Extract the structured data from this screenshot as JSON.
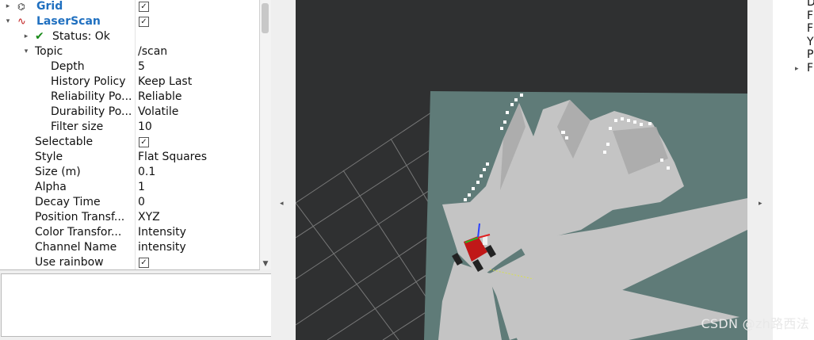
{
  "displays": {
    "items": [
      {
        "arrow": "▸",
        "icon": "grid-icon",
        "glyph": "⌬",
        "label": "Grid",
        "value": "",
        "checked": true,
        "blue": true
      },
      {
        "arrow": "▾",
        "icon": "laserscan-icon",
        "glyph": "∿",
        "label": "LaserScan",
        "value": "",
        "checked": true,
        "blue": true
      },
      {
        "arrow": "▸",
        "icon": "check-mark-icon",
        "glyph": "✔",
        "label": "Status: Ok",
        "value": "",
        "checked": null
      },
      {
        "arrow": "▾",
        "icon": "",
        "glyph": "",
        "label": "Topic",
        "value": "/scan",
        "checked": null
      },
      {
        "arrow": "",
        "icon": "",
        "glyph": "",
        "label": "Depth",
        "value": "5",
        "checked": null
      },
      {
        "arrow": "",
        "icon": "",
        "glyph": "",
        "label": "History Policy",
        "value": "Keep Last",
        "checked": null
      },
      {
        "arrow": "",
        "icon": "",
        "glyph": "",
        "label": "Reliability Po...",
        "value": "Reliable",
        "checked": null
      },
      {
        "arrow": "",
        "icon": "",
        "glyph": "",
        "label": "Durability Po...",
        "value": "Volatile",
        "checked": null
      },
      {
        "arrow": "",
        "icon": "",
        "glyph": "",
        "label": "Filter size",
        "value": "10",
        "checked": null
      },
      {
        "arrow": "",
        "icon": "",
        "glyph": "",
        "label": "Selectable",
        "value": "",
        "checked": true
      },
      {
        "arrow": "",
        "icon": "",
        "glyph": "",
        "label": "Style",
        "value": "Flat Squares",
        "checked": null
      },
      {
        "arrow": "",
        "icon": "",
        "glyph": "",
        "label": "Size (m)",
        "value": "0.1",
        "checked": null
      },
      {
        "arrow": "",
        "icon": "",
        "glyph": "",
        "label": "Alpha",
        "value": "1",
        "checked": null
      },
      {
        "arrow": "",
        "icon": "",
        "glyph": "",
        "label": "Decay Time",
        "value": "0",
        "checked": null
      },
      {
        "arrow": "",
        "icon": "",
        "glyph": "",
        "label": "Position Transf...",
        "value": "XYZ",
        "checked": null
      },
      {
        "arrow": "",
        "icon": "",
        "glyph": "",
        "label": "Color Transfor...",
        "value": "Intensity",
        "checked": null
      },
      {
        "arrow": "",
        "icon": "",
        "glyph": "",
        "label": "Channel Name",
        "value": "intensity",
        "checked": null
      },
      {
        "arrow": "",
        "icon": "",
        "glyph": "",
        "label": "Use rainbow",
        "value": "",
        "checked": true
      }
    ]
  },
  "right_panel": {
    "items": [
      "D",
      "F",
      "F",
      "Y",
      "P",
      "F"
    ]
  },
  "watermark": "CSDN @zh路西法",
  "colors": {
    "link_blue": "#2070c0",
    "viewport_bg": "#2f3031",
    "map_floor": "#5f7b78",
    "scan_gray": "#c8c8c8",
    "robot_red": "#c01818"
  }
}
